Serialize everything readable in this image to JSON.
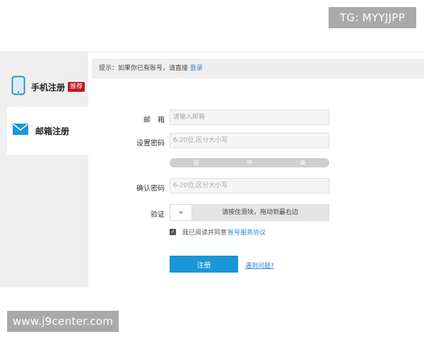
{
  "watermarks": {
    "top": "TG: MYYJJPP",
    "bottom": "www.j9center.com"
  },
  "sidebar": {
    "items": [
      {
        "label": "手机注册",
        "badge": "推荐",
        "icon": "phone-icon"
      },
      {
        "label": "邮箱注册",
        "icon": "envelope-icon"
      }
    ]
  },
  "hint": {
    "text": "提示：如果你已有账号，请直接",
    "link": "登录"
  },
  "form": {
    "email_label": "邮　箱",
    "email_placeholder": "请输入邮箱",
    "password_label": "设置密码",
    "password_placeholder": "6-20位,区分大小写",
    "strength": [
      "低",
      "中",
      "高"
    ],
    "confirm_label": "确认密码",
    "confirm_placeholder": "6-20位,区分大小写",
    "verify_label": "验证",
    "slider_handle": "»",
    "slider_text": "请按住滑块，拖动到最右边",
    "agree_text": "我已阅读并同意",
    "agree_link": "账号服务协议",
    "agree_checked": true,
    "submit_label": "注册",
    "help_link": "遇到问题?"
  },
  "colors": {
    "accent": "#1a96d9",
    "link": "#2f86cf",
    "badge": "#c4161c"
  }
}
